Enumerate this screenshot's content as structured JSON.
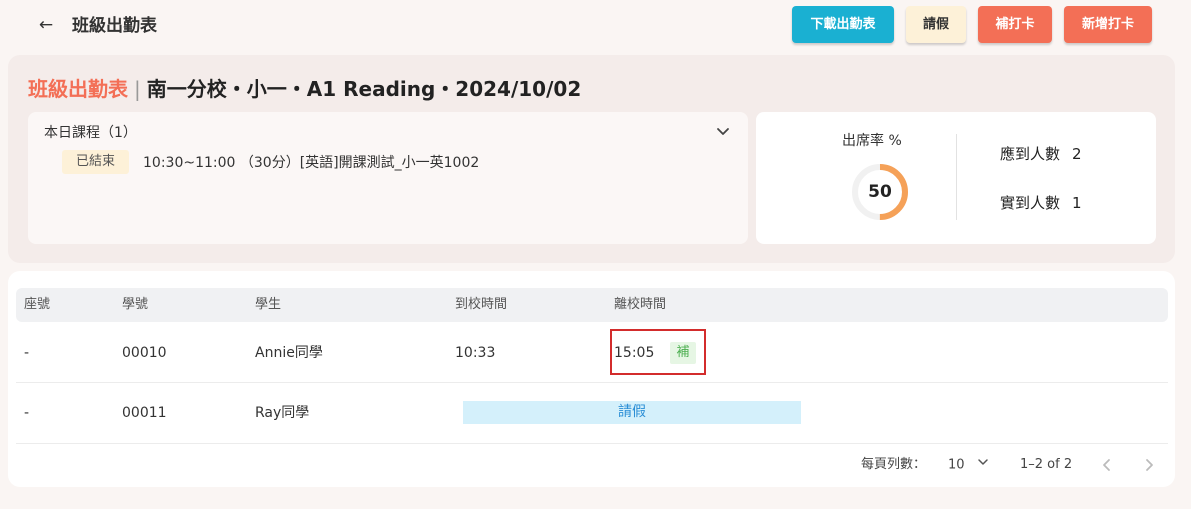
{
  "header": {
    "title": "班級出勤表",
    "buttons": {
      "download": "下載出勤表",
      "leave": "請假",
      "makeup": "補打卡",
      "add": "新增打卡"
    }
  },
  "summary": {
    "label": "班級出勤表",
    "separator": "|",
    "info": "南一分校・小一・A1 Reading・2024/10/02",
    "course_panel": {
      "title": "本日課程（1）",
      "status": "已結束",
      "detail": "10:30~11:00 （30分）[英語]開課測試_小一英1002"
    },
    "stats": {
      "rate_label": "出席率 %",
      "rate_value": "50",
      "rate_fraction": 0.5,
      "expected_label": "應到人數",
      "expected_value": "2",
      "actual_label": "實到人數",
      "actual_value": "1"
    }
  },
  "table": {
    "columns": [
      "座號",
      "學號",
      "學生",
      "到校時間",
      "離校時間"
    ],
    "rows": [
      {
        "seat": "-",
        "student_id": "00010",
        "name": "Annie同學",
        "arrive": "10:33",
        "leave": "15:05",
        "tag": "補"
      },
      {
        "seat": "-",
        "student_id": "00011",
        "name": "Ray同學",
        "status": "請假"
      }
    ]
  },
  "pagination": {
    "rows_per_page_label": "每頁列數：",
    "rows_per_page": "10",
    "range": "1–2 of 2"
  },
  "colors": {
    "accent": "#f36f56",
    "download_button": "#1ab0d2",
    "leave_button": "#fdf1d8",
    "ring": "#f5a158",
    "leave_bar": "#d4f0fb",
    "highlight_border": "#d32c2c"
  }
}
